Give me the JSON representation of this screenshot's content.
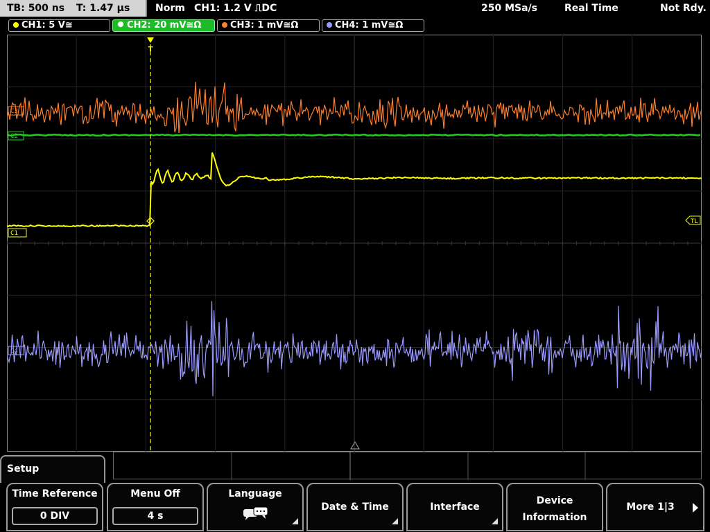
{
  "status": {
    "timebase": "TB: 500 ns",
    "trigger_time": "T: 1.47 µs",
    "mode": "Norm",
    "trigger_setting": "CH1: 1.2 V ⎍DC",
    "sample_rate": "250 MSa/s",
    "acq_mode": "Real Time",
    "state": "Not Rdy."
  },
  "channels": [
    {
      "label": "CH1: 5 V≅",
      "color": "#ffff00",
      "active": false
    },
    {
      "label": "CH2: 20 mV≅Ω",
      "color": "#22cc22",
      "active": true
    },
    {
      "label": "CH3: 1 mV≅Ω",
      "color": "#ff7f2a",
      "active": false
    },
    {
      "label": "CH4: 1 mV≅Ω",
      "color": "#9a9aff",
      "active": false
    }
  ],
  "markers": {
    "ch1": "C1",
    "ch2": "C2",
    "ch3": "C3",
    "ch4": "C4",
    "trigger_level": "TL",
    "trigger_pos": "T"
  },
  "menu": {
    "title": "Setup",
    "softkeys": [
      {
        "label": "Time Reference",
        "value": "0 DIV"
      },
      {
        "label": "Menu Off",
        "value": "4 s"
      },
      {
        "label": "Language",
        "icon": "speech-bubbles-icon"
      },
      {
        "label": "Date & Time"
      },
      {
        "label": "Interface"
      },
      {
        "label_line1": "Device",
        "label_line2": "Information"
      },
      {
        "label": "More 1|3"
      }
    ]
  }
}
